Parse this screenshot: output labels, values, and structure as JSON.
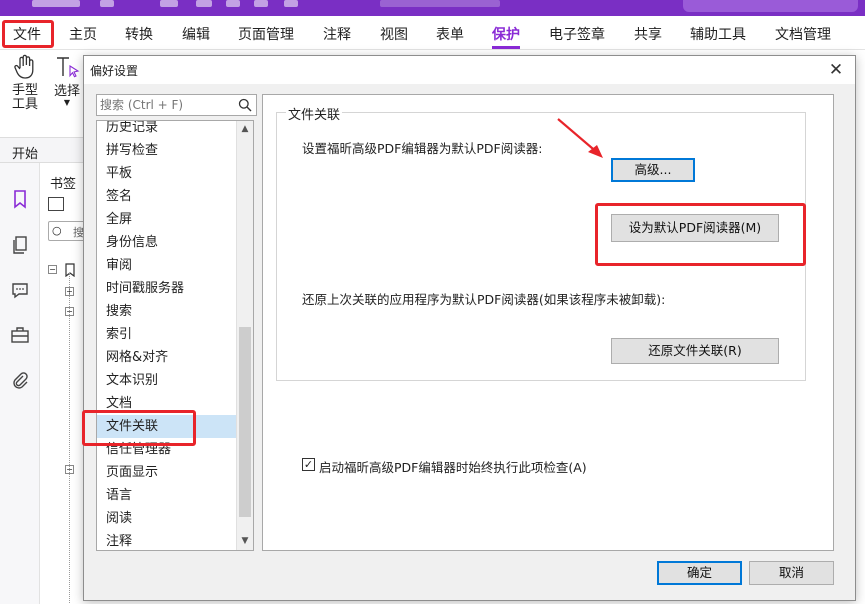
{
  "menubar": {
    "items": [
      "文件",
      "主页",
      "转换",
      "编辑",
      "页面管理",
      "注释",
      "视图",
      "表单",
      "保护",
      "电子签章",
      "共享",
      "辅助工具",
      "文档管理"
    ],
    "active": "保护"
  },
  "toolbar": {
    "hand_tool": "手型\n工具",
    "select_tool": "选择"
  },
  "start_tab": "开始",
  "bookmark_pane": {
    "title": "书签",
    "search_stub": "搜"
  },
  "dialog": {
    "title": "偏好设置",
    "search_placeholder": "搜索 (Ctrl + F)",
    "categories": [
      "历史记录",
      "拼写检查",
      "平板",
      "签名",
      "全屏",
      "身份信息",
      "审阅",
      "时间戳服务器",
      "搜索",
      "索引",
      "网格&对齐",
      "文本识别",
      "文档",
      "文件关联",
      "信任管理器",
      "页面显示",
      "语言",
      "阅读",
      "注释"
    ],
    "selected_category": "文件关联",
    "group_title": "文件关联",
    "set_default_label": "设置福昕高级PDF编辑器为默认PDF阅读器:",
    "advanced_button": "高级...",
    "set_default_button": "设为默认PDF阅读器(M)",
    "restore_label": "还原上次关联的应用程序为默认PDF阅读器(如果该程序未被卸载):",
    "restore_button": "还原文件关联(R)",
    "check_label": "启动福昕高级PDF编辑器时始终执行此项检查(A)",
    "check_checked": true,
    "ok_button": "确定",
    "cancel_button": "取消"
  },
  "colors": {
    "brand": "#7a2fc4",
    "active_tab": "#8a2bd6",
    "highlight_box": "#e8242a",
    "selection": "#cce4f7",
    "focus": "#0078d7"
  }
}
